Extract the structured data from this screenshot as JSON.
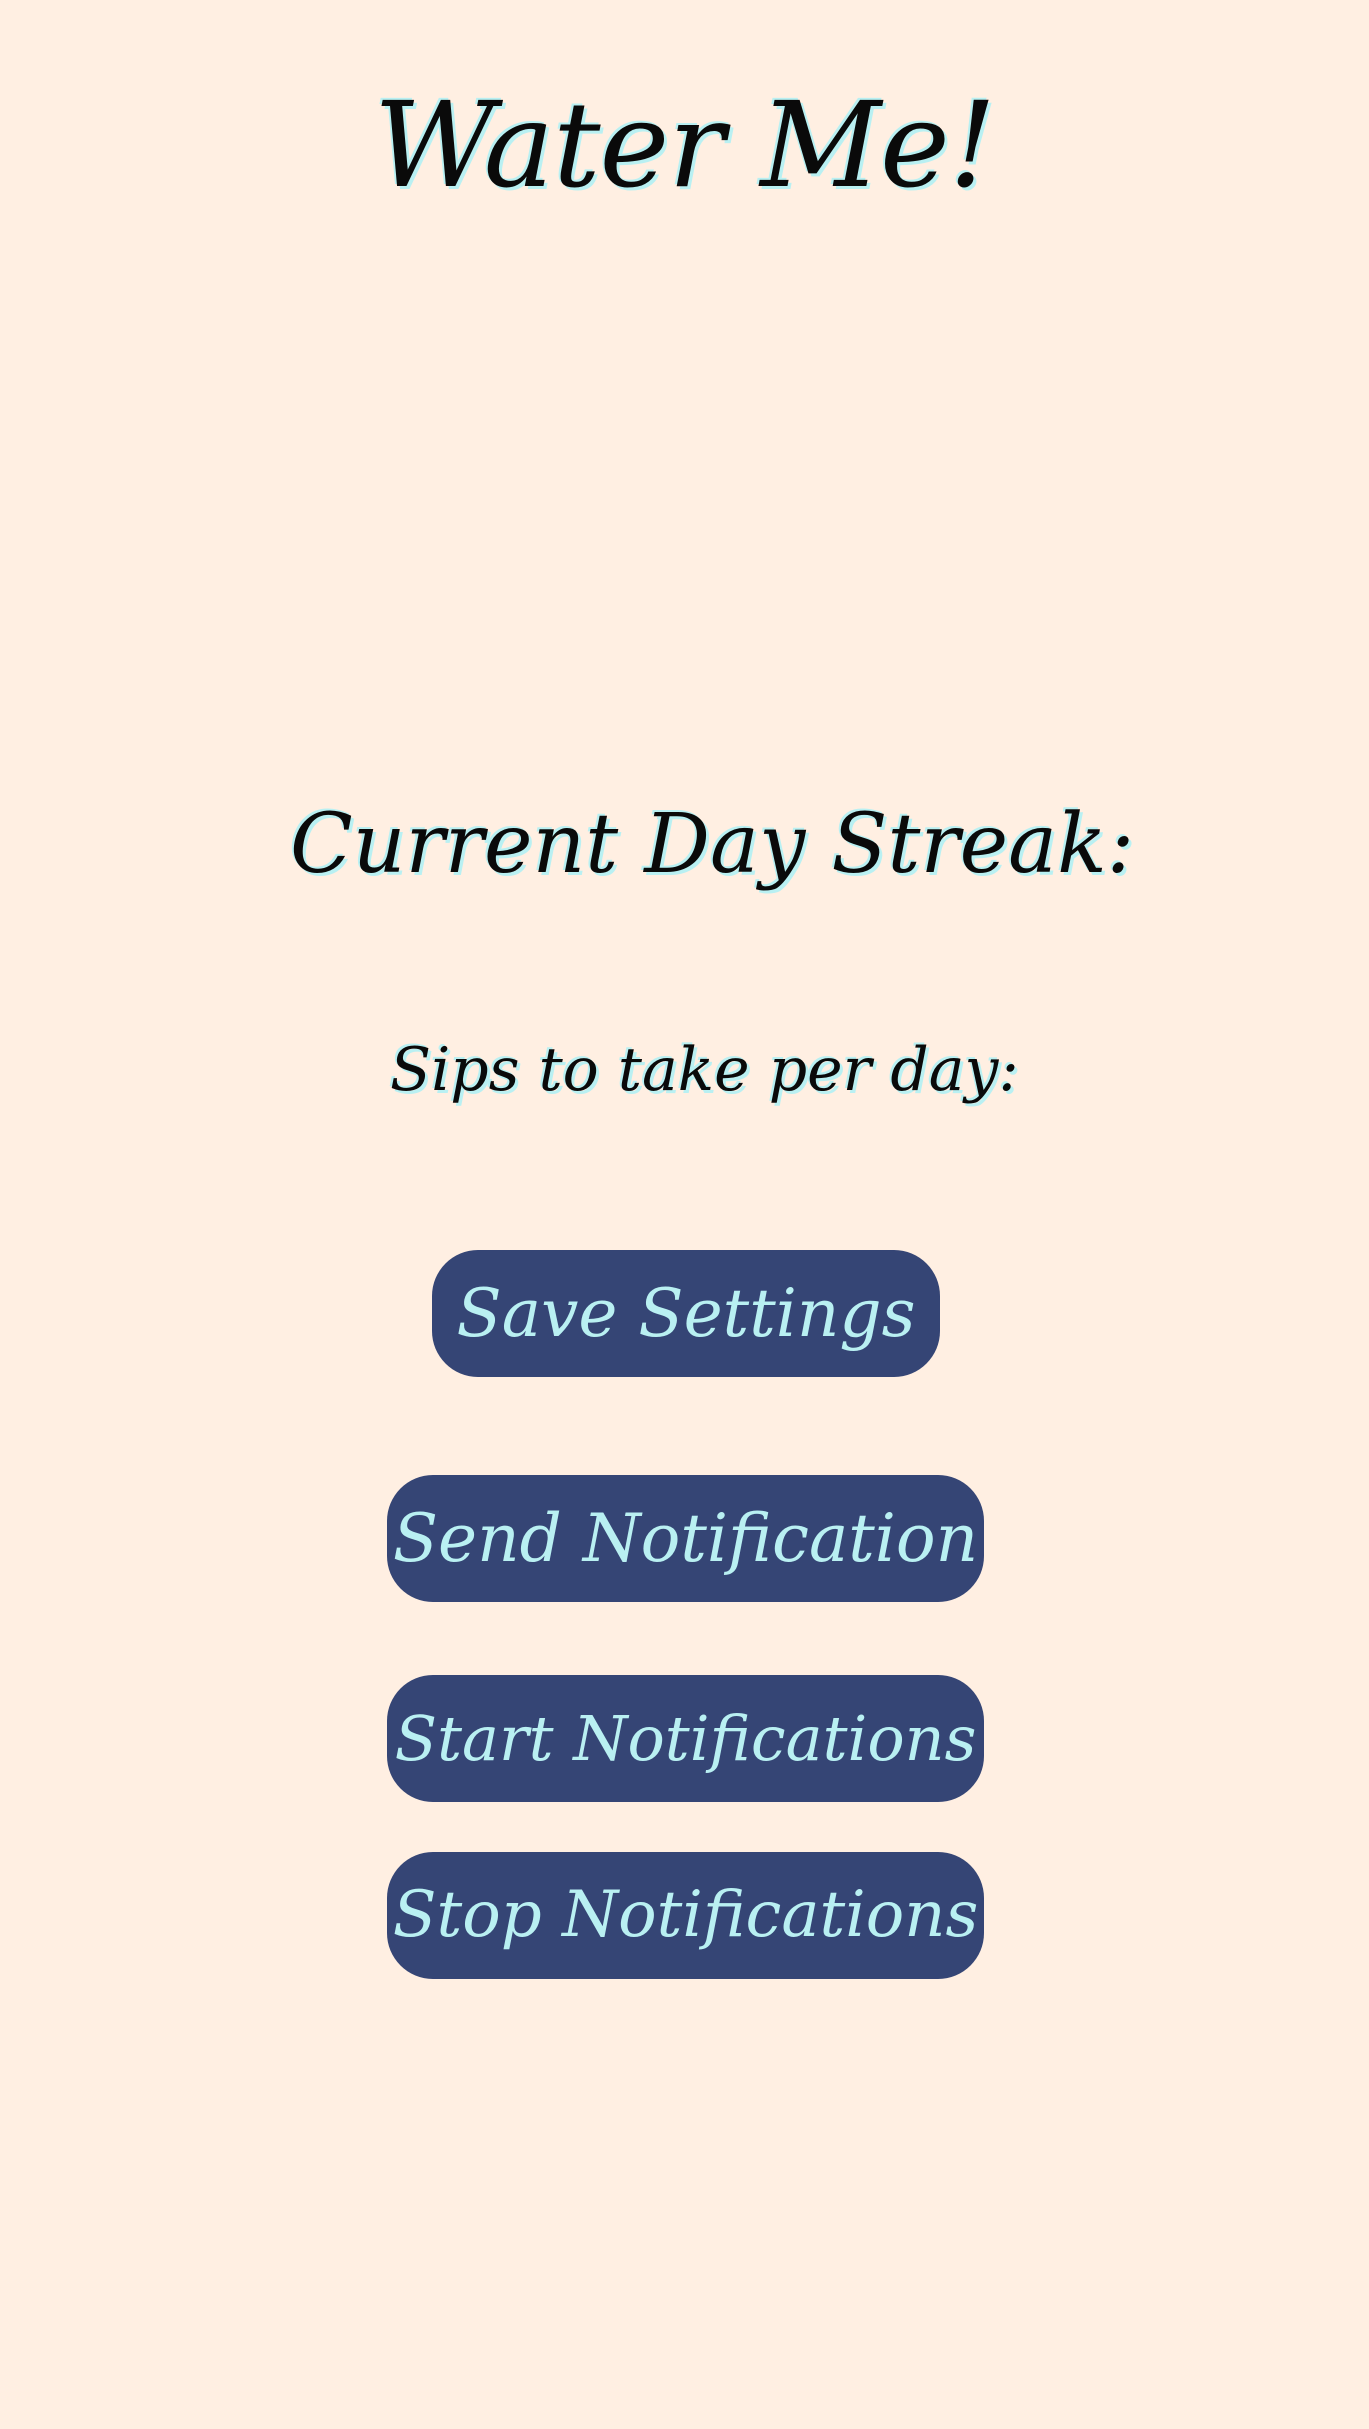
{
  "app": {
    "title": "Water Me!"
  },
  "stats": {
    "streak_label": "Current Day Streak:",
    "sips_label": "Sips to take per day:"
  },
  "buttons": {
    "save": "Save Settings",
    "send": "Send Notification",
    "start": "Start Notifications",
    "stop": "Stop Notifications"
  },
  "colors": {
    "background": "#ffefe2",
    "button": "#354575",
    "accent": "#b9f0f2",
    "text": "#0a0a0a"
  }
}
